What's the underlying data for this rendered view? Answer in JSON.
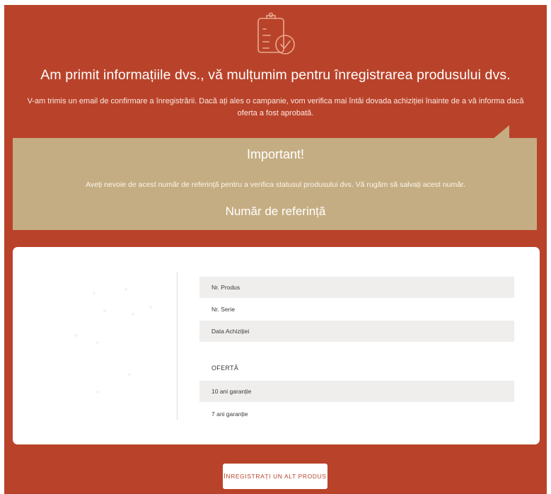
{
  "colors": {
    "brand_red": "#b9432a",
    "important_tan": "#c5ad83",
    "row_shade": "#efeeec"
  },
  "header": {
    "icon": "clipboard-check-icon",
    "headline": "Am primit informațiile dvs., vă mulțumim pentru înregistrarea produsului dvs.",
    "subtext": "V-am trimis un email de confirmare a înregistrării. Dacă ați ales o campanie, vom verifica mai întâi dovada achiziției înainte de a vă informa dacă oferta a fost aprobată."
  },
  "important": {
    "title": "Important!",
    "text": "Aveți nevoie de acest număr de referință pentru a verifica statusul produsului dvs. Vă rugăm să salvați acest număr.",
    "reference_label": "Număr de referință"
  },
  "product_card": {
    "image": "product-image-placeholder",
    "fields": [
      {
        "label": "Nr. Produs"
      },
      {
        "label": "Nr. Serie"
      },
      {
        "label": "Data Achiziției"
      }
    ],
    "offer_heading": "OFERTĂ",
    "offers": [
      {
        "label": "10 ani garanție"
      },
      {
        "label": "7 ani garanție"
      }
    ]
  },
  "actions": {
    "register_another": "ÎNREGISTRAȚI UN ALT PRODUS"
  }
}
